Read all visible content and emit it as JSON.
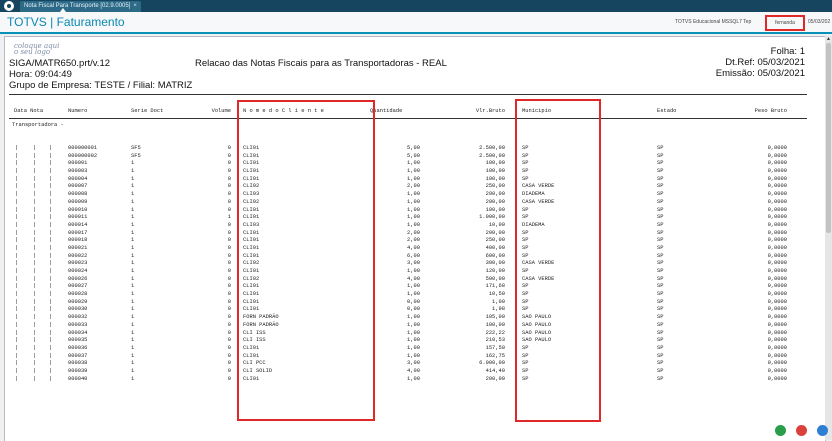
{
  "window": {
    "tab_title": "Nota Fiscal Para Transporte [02.9.0005]",
    "tab_close": "×"
  },
  "appbar": {
    "title": "TOTVS | Faturamento",
    "company": "TOTVS Educacional MSSQL7 Tep",
    "user": "fernanda",
    "date": "05/03/202"
  },
  "report": {
    "logo_line1": "coloque aqui",
    "logo_line2": "o seu logo",
    "program": "SIGA/MATR650.prt/v.12",
    "time": "Hora: 09:04:49",
    "company_line": "Grupo de Empresa: TESTE / Filial: MATRIZ",
    "title": "Relacao das Notas Fiscais para as Transportadoras - REAL",
    "page": "Folha:   1",
    "dt_ref": "Dt.Ref: 05/03/2021",
    "emission": "Emissão: 05/03/2021",
    "columns": {
      "date": "Data Nota",
      "number": "Numero",
      "series": "Serie Doct",
      "volume": "Volume",
      "client": "N o m e   d o   C l i e n t e",
      "quantity": "Quantidade",
      "value": "Vlr.Bruto",
      "city": "Municipio",
      "state": "Estado",
      "weight": "Peso Bruto"
    },
    "section": "Transportadora   -",
    "rows": [
      {
        "num": "000000001",
        "serie": "SF5",
        "vol": "0",
        "client": "CLI01",
        "qty": "5,00",
        "val": "2.500,00",
        "city": "SP",
        "uf": "SP",
        "peso": "0,0000"
      },
      {
        "num": "000000002",
        "serie": "SF5",
        "vol": "0",
        "client": "CLI01",
        "qty": "5,00",
        "val": "2.500,00",
        "city": "SP",
        "uf": "SP",
        "peso": "0,0000"
      },
      {
        "num": "000001",
        "serie": "1",
        "vol": "0",
        "client": "CLI01",
        "qty": "1,00",
        "val": "100,00",
        "city": "SP",
        "uf": "SP",
        "peso": "0,0000"
      },
      {
        "num": "000003",
        "serie": "1",
        "vol": "0",
        "client": "CLI01",
        "qty": "1,00",
        "val": "100,00",
        "city": "SP",
        "uf": "SP",
        "peso": "0,0000"
      },
      {
        "num": "000004",
        "serie": "1",
        "vol": "0",
        "client": "CLI01",
        "qty": "1,00",
        "val": "100,00",
        "city": "SP",
        "uf": "SP",
        "peso": "0,0000"
      },
      {
        "num": "000007",
        "serie": "1",
        "vol": "0",
        "client": "CLI02",
        "qty": "2,00",
        "val": "250,00",
        "city": "CASA VERDE",
        "uf": "SP",
        "peso": "0,0000"
      },
      {
        "num": "000008",
        "serie": "1",
        "vol": "0",
        "client": "CLI03",
        "qty": "1,00",
        "val": "200,00",
        "city": "DIADEMA",
        "uf": "SP",
        "peso": "0,0000"
      },
      {
        "num": "000009",
        "serie": "1",
        "vol": "0",
        "client": "CLI02",
        "qty": "1,00",
        "val": "200,00",
        "city": "CASA VERDE",
        "uf": "SP",
        "peso": "0,0000"
      },
      {
        "num": "000010",
        "serie": "1",
        "vol": "0",
        "client": "CLI01",
        "qty": "1,00",
        "val": "100,00",
        "city": "SP",
        "uf": "SP",
        "peso": "0,0000"
      },
      {
        "num": "000011",
        "serie": "1",
        "vol": "1",
        "client": "CLI01",
        "qty": "1,00",
        "val": "1.000,00",
        "city": "SP",
        "uf": "SP",
        "peso": "0,0000"
      },
      {
        "num": "000014",
        "serie": "1",
        "vol": "0",
        "client": "CLI03",
        "qty": "1,00",
        "val": "10,00",
        "city": "DIADEMA",
        "uf": "SP",
        "peso": "0,0000"
      },
      {
        "num": "000017",
        "serie": "1",
        "vol": "0",
        "client": "CLI01",
        "qty": "2,00",
        "val": "200,00",
        "city": "SP",
        "uf": "SP",
        "peso": "0,0000"
      },
      {
        "num": "000018",
        "serie": "1",
        "vol": "0",
        "client": "CLI01",
        "qty": "2,00",
        "val": "250,00",
        "city": "SP",
        "uf": "SP",
        "peso": "0,0000"
      },
      {
        "num": "000021",
        "serie": "1",
        "vol": "0",
        "client": "CLI01",
        "qty": "4,00",
        "val": "400,00",
        "city": "SP",
        "uf": "SP",
        "peso": "0,0000"
      },
      {
        "num": "000022",
        "serie": "1",
        "vol": "0",
        "client": "CLI01",
        "qty": "6,00",
        "val": "600,00",
        "city": "SP",
        "uf": "SP",
        "peso": "0,0000"
      },
      {
        "num": "000023",
        "serie": "1",
        "vol": "0",
        "client": "CLI02",
        "qty": "3,00",
        "val": "300,00",
        "city": "CASA VERDE",
        "uf": "SP",
        "peso": "0,0000"
      },
      {
        "num": "000024",
        "serie": "1",
        "vol": "0",
        "client": "CLI01",
        "qty": "1,00",
        "val": "120,00",
        "city": "SP",
        "uf": "SP",
        "peso": "0,0000"
      },
      {
        "num": "000026",
        "serie": "1",
        "vol": "0",
        "client": "CLI02",
        "qty": "4,00",
        "val": "500,00",
        "city": "CASA VERDE",
        "uf": "SP",
        "peso": "0,0000"
      },
      {
        "num": "000027",
        "serie": "1",
        "vol": "0",
        "client": "CLI01",
        "qty": "1,00",
        "val": "171,68",
        "city": "SP",
        "uf": "SP",
        "peso": "0,0000"
      },
      {
        "num": "000028",
        "serie": "1",
        "vol": "0",
        "client": "CLI01",
        "qty": "1,00",
        "val": "10,50",
        "city": "SP",
        "uf": "SP",
        "peso": "0,0000"
      },
      {
        "num": "000029",
        "serie": "1",
        "vol": "0",
        "client": "CLI01",
        "qty": "0,00",
        "val": "1,00",
        "city": "SP",
        "uf": "SP",
        "peso": "0,0000"
      },
      {
        "num": "000030",
        "serie": "1",
        "vol": "0",
        "client": "CLI01",
        "qty": "0,00",
        "val": "1,98",
        "city": "SP",
        "uf": "SP",
        "peso": "0,0000"
      },
      {
        "num": "000032",
        "serie": "1",
        "vol": "0",
        "client": "FORN PADRÃO",
        "qty": "1,00",
        "val": "105,00",
        "city": "SAO PAULO",
        "uf": "SP",
        "peso": "0,0000"
      },
      {
        "num": "000033",
        "serie": "1",
        "vol": "0",
        "client": "FORN PADRÃO",
        "qty": "1,00",
        "val": "100,00",
        "city": "SAO PAULO",
        "uf": "SP",
        "peso": "0,0000"
      },
      {
        "num": "000034",
        "serie": "1",
        "vol": "0",
        "client": "CLI ISS",
        "qty": "1,00",
        "val": "222,22",
        "city": "SAO PAULO",
        "uf": "SP",
        "peso": "0,0000"
      },
      {
        "num": "000035",
        "serie": "1",
        "vol": "0",
        "client": "CLI ISS",
        "qty": "1,00",
        "val": "210,53",
        "city": "SAO PAULO",
        "uf": "SP",
        "peso": "0,0000"
      },
      {
        "num": "000036",
        "serie": "1",
        "vol": "0",
        "client": "CLI01",
        "qty": "1,00",
        "val": "157,50",
        "city": "SP",
        "uf": "SP",
        "peso": "0,0000"
      },
      {
        "num": "000037",
        "serie": "1",
        "vol": "0",
        "client": "CLI01",
        "qty": "1,00",
        "val": "162,75",
        "city": "SP",
        "uf": "SP",
        "peso": "0,0000"
      },
      {
        "num": "000038",
        "serie": "1",
        "vol": "0",
        "client": "CLI PCC",
        "qty": "3,00",
        "val": "6.000,00",
        "city": "SP",
        "uf": "SP",
        "peso": "0,0000"
      },
      {
        "num": "000039",
        "serie": "1",
        "vol": "0",
        "client": "CLI SOLID",
        "qty": "4,00",
        "val": "414,40",
        "city": "SP",
        "uf": "SP",
        "peso": "0,0000"
      },
      {
        "num": "000040",
        "serie": "1",
        "vol": "0",
        "client": "CLI01",
        "qty": "1,00",
        "val": "200,00",
        "city": "SP",
        "uf": "SP",
        "peso": "0,0000"
      }
    ]
  },
  "taskbar_icons": [
    "shield-icon",
    "s-app-icon",
    "browser-icon"
  ],
  "colors": {
    "titlebar": "#16455f",
    "accent": "#0a88b0",
    "highlight": "#e02828"
  }
}
